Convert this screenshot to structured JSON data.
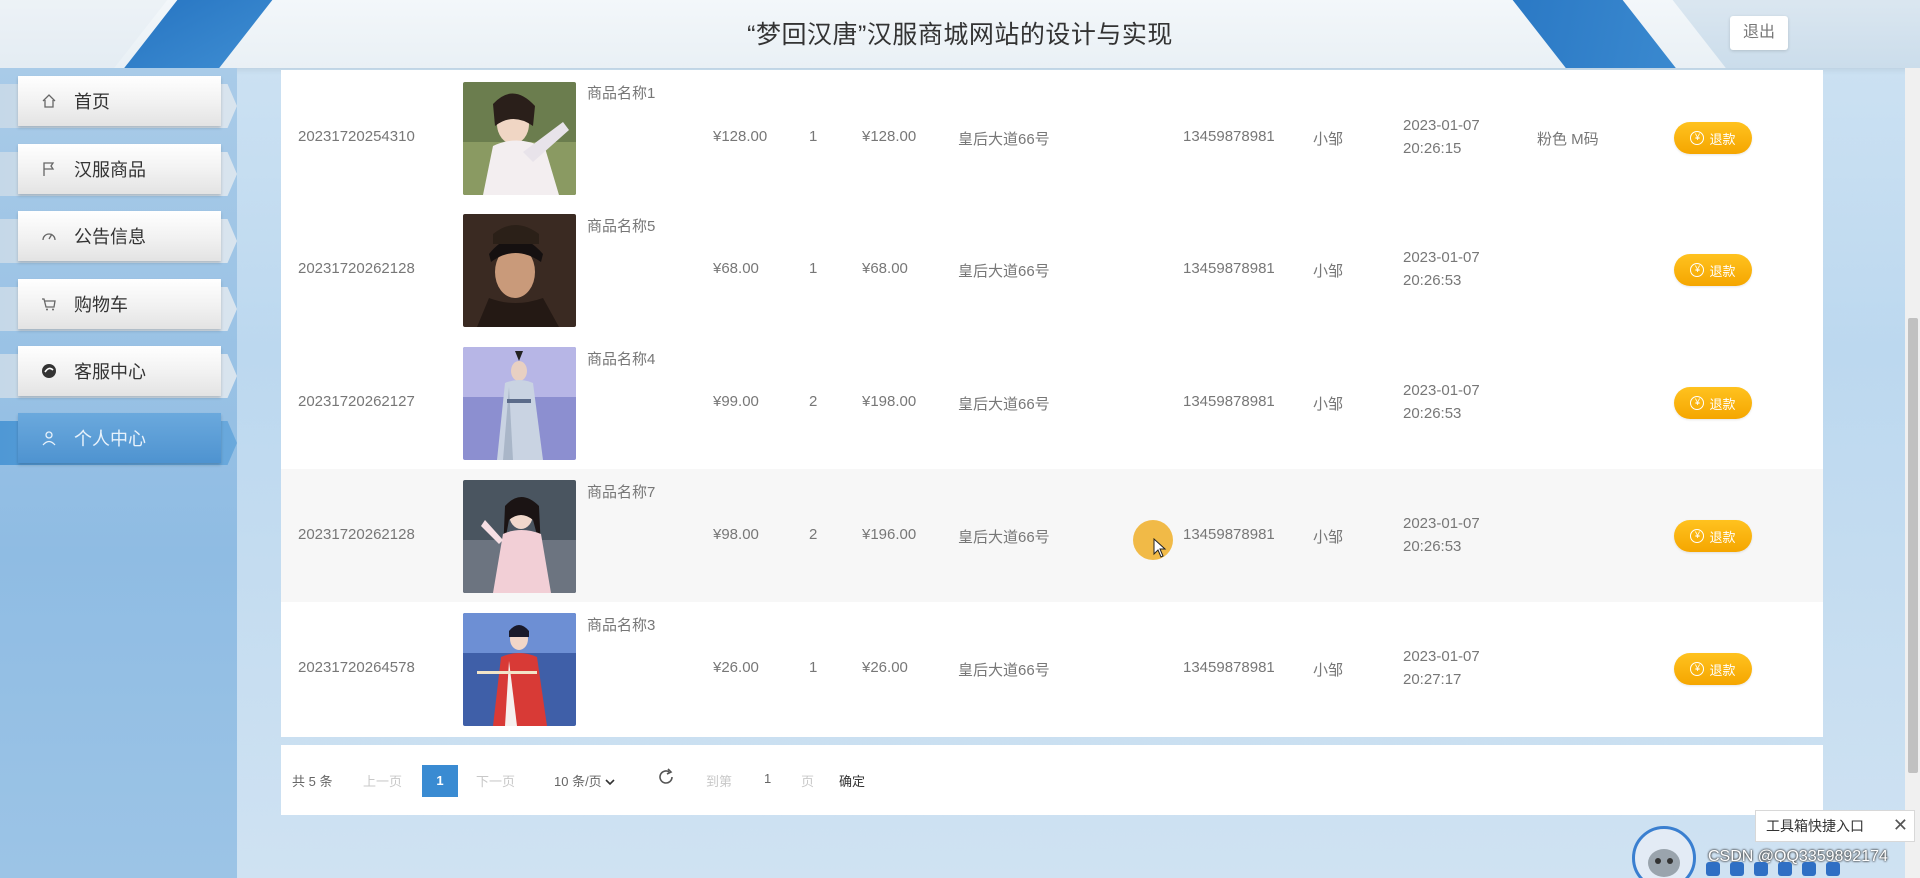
{
  "header": {
    "title": "“梦回汉唐”汉服商城网站的设计与实现",
    "logout_label": "退出"
  },
  "sidebar": {
    "items": [
      {
        "label": "首页",
        "icon": "home-icon"
      },
      {
        "label": "汉服商品",
        "icon": "flag-icon"
      },
      {
        "label": "公告信息",
        "icon": "dashboard-icon"
      },
      {
        "label": "购物车",
        "icon": "cart-icon"
      },
      {
        "label": "客服中心",
        "icon": "chat-icon"
      },
      {
        "label": "个人中心",
        "icon": "user-icon",
        "active": true
      }
    ]
  },
  "orders": [
    {
      "order_no": "20231720254310",
      "name": "商品名称1",
      "price": "¥128.00",
      "qty": "1",
      "total": "¥128.00",
      "address": "皇后大道66号",
      "phone": "13459878981",
      "receiver": "小邹",
      "date": "2023-01-07",
      "time": "20:26:15",
      "spec": "粉色 M码",
      "action": "退款"
    },
    {
      "order_no": "20231720262128",
      "name": "商品名称5",
      "price": "¥68.00",
      "qty": "1",
      "total": "¥68.00",
      "address": "皇后大道66号",
      "phone": "13459878981",
      "receiver": "小邹",
      "date": "2023-01-07",
      "time": "20:26:53",
      "spec": "",
      "action": "退款"
    },
    {
      "order_no": "20231720262127",
      "name": "商品名称4",
      "price": "¥99.00",
      "qty": "2",
      "total": "¥198.00",
      "address": "皇后大道66号",
      "phone": "13459878981",
      "receiver": "小邹",
      "date": "2023-01-07",
      "time": "20:26:53",
      "spec": "",
      "action": "退款"
    },
    {
      "order_no": "20231720262128",
      "name": "商品名称7",
      "price": "¥98.00",
      "qty": "2",
      "total": "¥196.00",
      "address": "皇后大道66号",
      "phone": "13459878981",
      "receiver": "小邹",
      "date": "2023-01-07",
      "time": "20:26:53",
      "spec": "",
      "action": "退款"
    },
    {
      "order_no": "20231720264578",
      "name": "商品名称3",
      "price": "¥26.00",
      "qty": "1",
      "total": "¥26.00",
      "address": "皇后大道66号",
      "phone": "13459878981",
      "receiver": "小邹",
      "date": "2023-01-07",
      "time": "20:27:17",
      "spec": "",
      "action": "退款"
    }
  ],
  "pagination": {
    "total": "共 5 条",
    "prev": "上一页",
    "current": "1",
    "next": "下一页",
    "page_size": "10 条/页",
    "goto": "到第",
    "goto_value": "1",
    "page_unit": "页",
    "confirm": "确定"
  },
  "widgets": {
    "toolbox_label": "工具箱快捷入口",
    "watermark": "CSDN @QQ3359892174"
  },
  "colors": {
    "accent": "#3a8bd2",
    "refund": "#f5a600",
    "sidebar": "#8fbce3"
  }
}
